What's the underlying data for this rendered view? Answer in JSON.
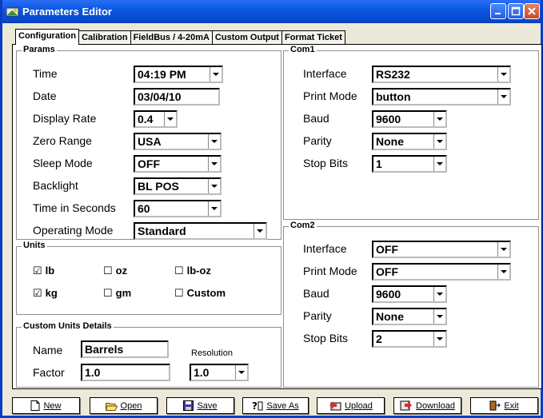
{
  "window": {
    "title": "Parameters Editor"
  },
  "tabs": [
    {
      "label": "Configuration",
      "active": true
    },
    {
      "label": "Calibration",
      "active": false
    },
    {
      "label": "FieldBus / 4-20mA",
      "active": false
    },
    {
      "label": "Custom Output",
      "active": false
    },
    {
      "label": "Format Ticket",
      "active": false
    }
  ],
  "params": {
    "legend": "Params",
    "time": {
      "label": "Time",
      "value": "04:19 PM"
    },
    "date": {
      "label": "Date",
      "value": "03/04/10"
    },
    "display_rate": {
      "label": "Display Rate",
      "value": "0.4"
    },
    "zero_range": {
      "label": "Zero Range",
      "value": "USA"
    },
    "sleep_mode": {
      "label": "Sleep Mode",
      "value": "OFF"
    },
    "backlight": {
      "label": "Backlight",
      "value": "BL POS"
    },
    "time_in_seconds": {
      "label": "Time in Seconds",
      "value": "60"
    },
    "operating_mode": {
      "label": "Operating Mode",
      "value": "Standard"
    }
  },
  "units": {
    "legend": "Units",
    "lb": {
      "label": "lb",
      "checked": true
    },
    "oz": {
      "label": "oz",
      "checked": false
    },
    "lb_oz": {
      "label": "lb-oz",
      "checked": false
    },
    "kg": {
      "label": "kg",
      "checked": true
    },
    "gm": {
      "label": "gm",
      "checked": false
    },
    "custom": {
      "label": "Custom",
      "checked": false
    },
    "checked_glyph": "☑",
    "unchecked_glyph": "☐"
  },
  "custom_units": {
    "legend": "Custom Units Details",
    "name": {
      "label": "Name",
      "value": "Barrels"
    },
    "factor": {
      "label": "Factor",
      "value": "1.0"
    },
    "resolution": {
      "label": "Resolution",
      "value": "1.0"
    }
  },
  "com1": {
    "legend": "Com1",
    "interface": {
      "label": "Interface",
      "value": "RS232"
    },
    "print_mode": {
      "label": "Print Mode",
      "value": "button"
    },
    "baud": {
      "label": "Baud",
      "value": "9600"
    },
    "parity": {
      "label": "Parity",
      "value": "None"
    },
    "stop_bits": {
      "label": "Stop Bits",
      "value": "1"
    }
  },
  "com2": {
    "legend": "Com2",
    "interface": {
      "label": "Interface",
      "value": "OFF"
    },
    "print_mode": {
      "label": "Print Mode",
      "value": "OFF"
    },
    "baud": {
      "label": "Baud",
      "value": "9600"
    },
    "parity": {
      "label": "Parity",
      "value": "None"
    },
    "stop_bits": {
      "label": "Stop Bits",
      "value": "2"
    }
  },
  "buttons": {
    "new": {
      "label": "New",
      "icon": "new-document-icon"
    },
    "open": {
      "label": "Open",
      "icon": "folder-open-icon"
    },
    "save": {
      "label": "Save",
      "icon": "save-icon"
    },
    "save_as": {
      "label": "Save As",
      "icon": "save-as-icon"
    },
    "upload": {
      "label": "Upload",
      "icon": "upload-icon"
    },
    "download": {
      "label": "Download",
      "icon": "download-icon"
    },
    "exit": {
      "label": "Exit",
      "icon": "exit-icon"
    }
  },
  "colors": {
    "titlebar": "#0a58e3",
    "window_bg": "#ece9d8",
    "panel_bg": "#ffffff"
  }
}
